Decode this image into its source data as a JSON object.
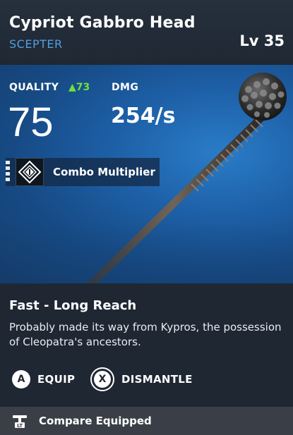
{
  "header": {
    "title": "Cypriot Gabbro Head",
    "subtitle": "SCEPTER",
    "level": "Lv 35"
  },
  "stats": {
    "quality_label": "QUALITY",
    "quality_delta": "73",
    "quality_value": "75",
    "dmg_label": "DMG",
    "dmg_value": "254/s"
  },
  "perk": {
    "label": "Combo Multiplier",
    "icon": "combo-multiplier-icon"
  },
  "description": {
    "title": "Fast - Long Reach",
    "text": "Probably made its way from Kypros, the possession of Cleopatra's ancestors."
  },
  "actions": {
    "equip_key": "A",
    "equip_label": "EQUIP",
    "dismantle_key": "X",
    "dismantle_label": "DISMANTLE"
  },
  "footer": {
    "compare_label": "Compare Equipped",
    "icon": "compare-icon"
  },
  "colors": {
    "accent_blue": "#4f9fe3",
    "quality_up_green": "#6fe13a",
    "hero_blue": "#1d5fa6"
  }
}
